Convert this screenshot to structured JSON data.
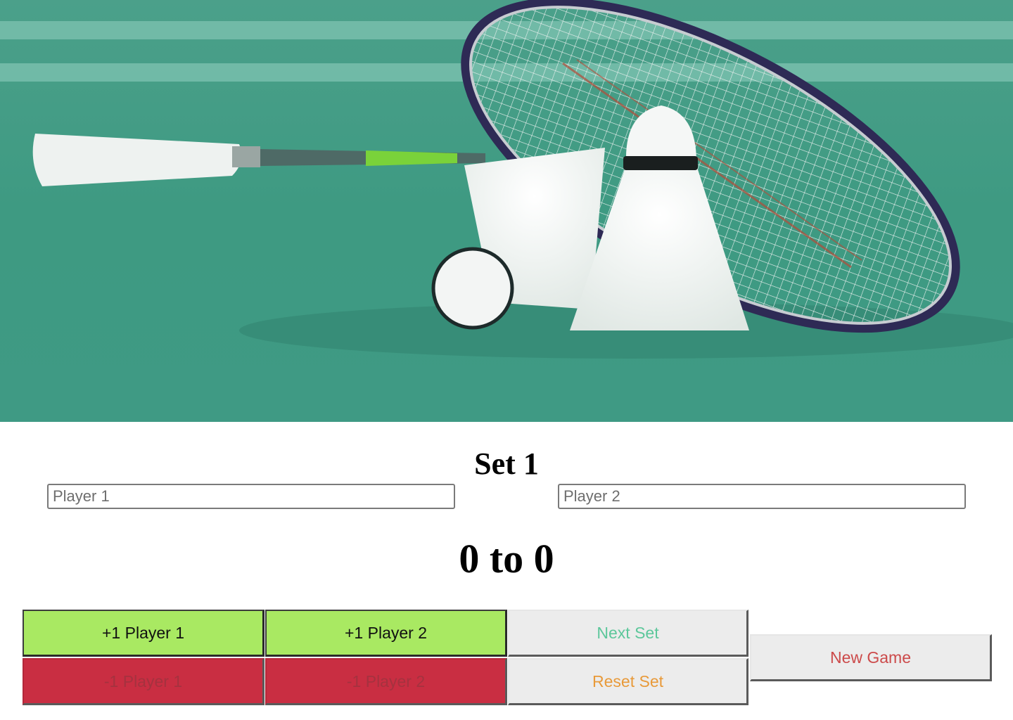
{
  "title": "Set 1",
  "players": {
    "p1_placeholder": "Player 1",
    "p2_placeholder": "Player 2"
  },
  "score": "0 to 0",
  "buttons": {
    "plus_p1": "+1 Player 1",
    "plus_p2": "+1 Player 2",
    "minus_p1": "-1 Player 1",
    "minus_p2": "-1 Player 2",
    "next_set": "Next Set",
    "reset_set": "Reset Set",
    "new_game": "New Game"
  },
  "colors": {
    "plus": "#a9e962",
    "minus": "#c92e42",
    "next_set_text": "#5dc79b",
    "reset_set_text": "#e89a3a",
    "new_game_text": "#cc4a4a",
    "court": "#3f9e86"
  },
  "hero": {
    "icon": "badminton-racket-shuttlecock-image"
  }
}
